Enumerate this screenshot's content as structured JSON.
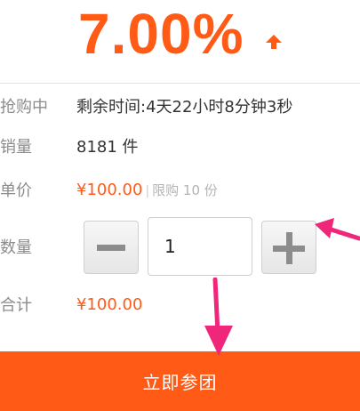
{
  "rate": {
    "value": "7.00%",
    "trend_icon": "arrow-up-icon",
    "color": "#ff5a16"
  },
  "rows": {
    "countdown": {
      "label": "抢购中",
      "value": "剩余时间:4天22小时8分钟3秒"
    },
    "sales": {
      "label": "销量",
      "value": "8181 件"
    },
    "unit_price": {
      "label": "单价",
      "value": "¥100.00",
      "separator": "|",
      "limit": "限购 10 份"
    },
    "quantity": {
      "label": "数量",
      "value": "1",
      "minus_icon": "minus-icon",
      "plus_icon": "plus-icon"
    },
    "total": {
      "label": "合计",
      "value": "¥100.00"
    }
  },
  "cta": {
    "label": "立即参团",
    "color": "#ff5a16"
  },
  "annotations": {
    "color": "#f0267a",
    "icons": [
      "pointer-arrow-icon",
      "pointer-arrow-icon"
    ]
  }
}
